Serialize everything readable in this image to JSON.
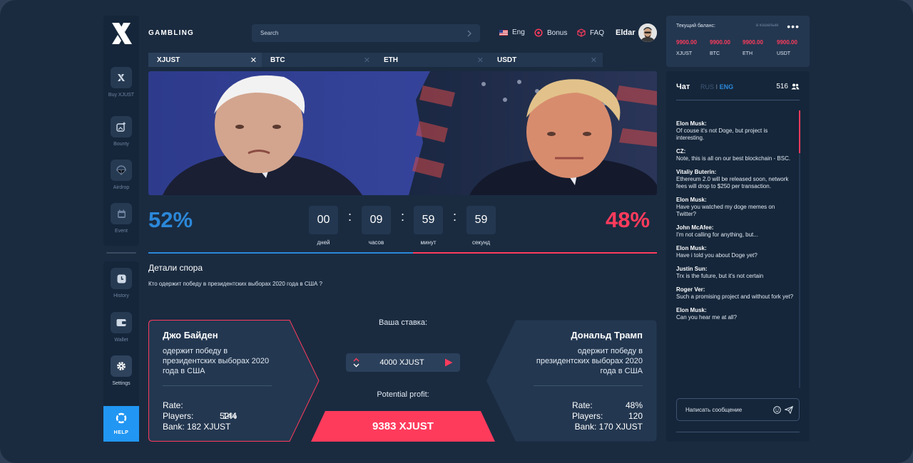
{
  "app": {
    "brand": "GAMBLING"
  },
  "colors": {
    "bg": "#1a2b40",
    "panel": "#233750",
    "accent_blue": "#2b88d9",
    "accent_red": "#ff3b5c",
    "help_blue": "#2196f3"
  },
  "sidebar": {
    "items": [
      {
        "label": "Buy XJUST",
        "icon": "x-logo-icon"
      },
      {
        "label": "Bounty",
        "icon": "image-plus-icon"
      },
      {
        "label": "Airdrop",
        "icon": "parachute-icon"
      },
      {
        "label": "Event",
        "icon": "calendar-icon"
      }
    ],
    "bottom_items": [
      {
        "label": "History",
        "icon": "clock-icon"
      },
      {
        "label": "Wallet",
        "icon": "wallet-icon"
      },
      {
        "label": "Settings",
        "icon": "gear-icon"
      }
    ],
    "help_label": "HELP"
  },
  "header": {
    "search_placeholder": "Search",
    "language": "Eng",
    "bonus": "Bonus",
    "faq": "FAQ",
    "user_name": "Eldar"
  },
  "currency_tabs": [
    {
      "label": "XJUST",
      "active": true
    },
    {
      "label": "BTC",
      "active": false
    },
    {
      "label": "ETH",
      "active": false
    },
    {
      "label": "USDT",
      "active": false
    }
  ],
  "odds": {
    "left_percent": "52%",
    "right_percent": "48%",
    "left_share": 0.52
  },
  "timer": {
    "days": "00",
    "hours": "09",
    "minutes": "59",
    "seconds": "59",
    "days_label": "дней",
    "hours_label": "часов",
    "minutes_label": "минут",
    "seconds_label": "секунд"
  },
  "details": {
    "title": "Детали спора",
    "question": "Кто одержит победу в президентских выборах  2020 года в США ?"
  },
  "candidate_left": {
    "name": "Джо Байден",
    "desc": "одержит победу в президентских выборах 2020 года в США",
    "rate_label": "Rate:",
    "rate": "52%",
    "players_label": "Players:",
    "players": "144",
    "bank_label": "Bank:",
    "bank": "182 XJUST"
  },
  "candidate_right": {
    "name": "Дональд Трамп",
    "desc": "одержит победу в президентских выборах 2020 года в США",
    "rate_label": "Rate:",
    "rate": "48%",
    "players_label": "Players:",
    "players": "120",
    "bank_label": "Bank:",
    "bank": "170 XJUST"
  },
  "bet": {
    "title": "Ваша ставка:",
    "value": "4000 XJUST",
    "profit_label": "Potential profit:",
    "profit_value": "9383 XJUST"
  },
  "balance": {
    "title": "Текущий баланс:",
    "wallet_hint": "в кошельке",
    "items": [
      {
        "value": "9900.00",
        "currency": "XJUST"
      },
      {
        "value": "9900.00",
        "currency": "BTC"
      },
      {
        "value": "9900.00",
        "currency": "ETH"
      },
      {
        "value": "9900.00",
        "currency": "USDT"
      }
    ]
  },
  "chat": {
    "title": "Чат",
    "lang_rus": "RUS",
    "lang_sep": "I",
    "lang_eng": "ENG",
    "online_count": "516",
    "messages": [
      {
        "author": "Elon Musk:",
        "text": "Of couse it's not Doge, but project is interesting."
      },
      {
        "author": "CZ:",
        "text": "Note, this is all on our best blockchain - BSC."
      },
      {
        "author": "Vitaliy Buterin:",
        "text": "Ethereum 2.0 will be released soon, network fees will drop to $250 per transaction."
      },
      {
        "author": "Elon Musk:",
        "text": "Have you watched my doge memes on Twitter?"
      },
      {
        "author": "John McAfee:",
        "text": "I'm not calling for anything, but..."
      },
      {
        "author": "Elon Musk:",
        "text": "Have i told you about Doge yet?"
      },
      {
        "author": "Justin Sun:",
        "text": "Trx is the future, but it's not certain"
      },
      {
        "author": "Roger Ver:",
        "text": "Such a promising project and without fork yet?"
      },
      {
        "author": "Elon Musk:",
        "text": "Can you hear me at all?"
      }
    ],
    "input_placeholder": "Написать сообщение"
  }
}
